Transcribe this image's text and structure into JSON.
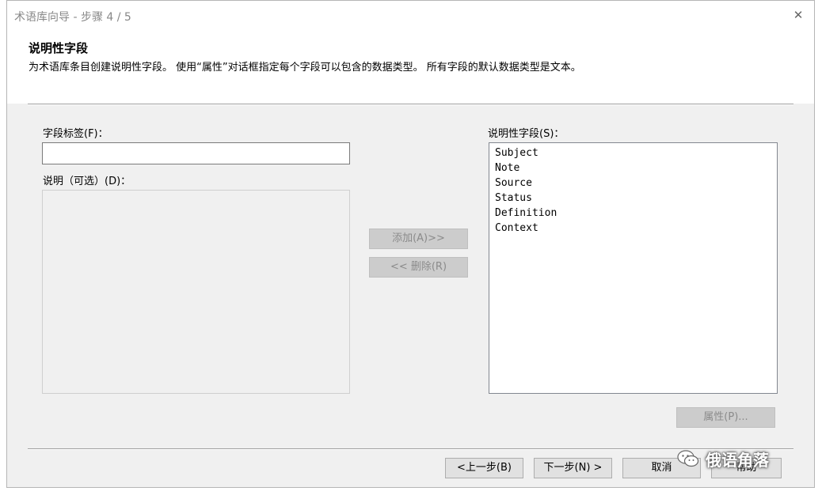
{
  "window": {
    "title": "术语库向导 - 步骤 4 / 5",
    "close_glyph": "✕"
  },
  "header": {
    "heading": "说明性字段",
    "description": "为术语库条目创建说明性字段。 使用“属性”对话框指定每个字段可以包含的数据类型。 所有字段的默认数据类型是文本。"
  },
  "form": {
    "field_label_caption": "字段标签(F)：",
    "field_label_value": "",
    "description_caption": "说明（可选）(D)：",
    "description_value": ""
  },
  "middle_buttons": {
    "add_label": "添加(A)>>",
    "remove_label": "<< 删除(R)"
  },
  "descriptive_fields": {
    "caption": "说明性字段(S)：",
    "items": [
      "Subject",
      "Note",
      "Source",
      "Status",
      "Definition",
      "Context"
    ]
  },
  "properties_button": "属性(P)...",
  "footer": {
    "back_label": "<上一步(B)",
    "next_label": "下一步(N) >",
    "cancel_label": "取消",
    "help_label": "帮助"
  },
  "watermark": {
    "text": "俄语角落",
    "icon": "wechat-icon"
  }
}
